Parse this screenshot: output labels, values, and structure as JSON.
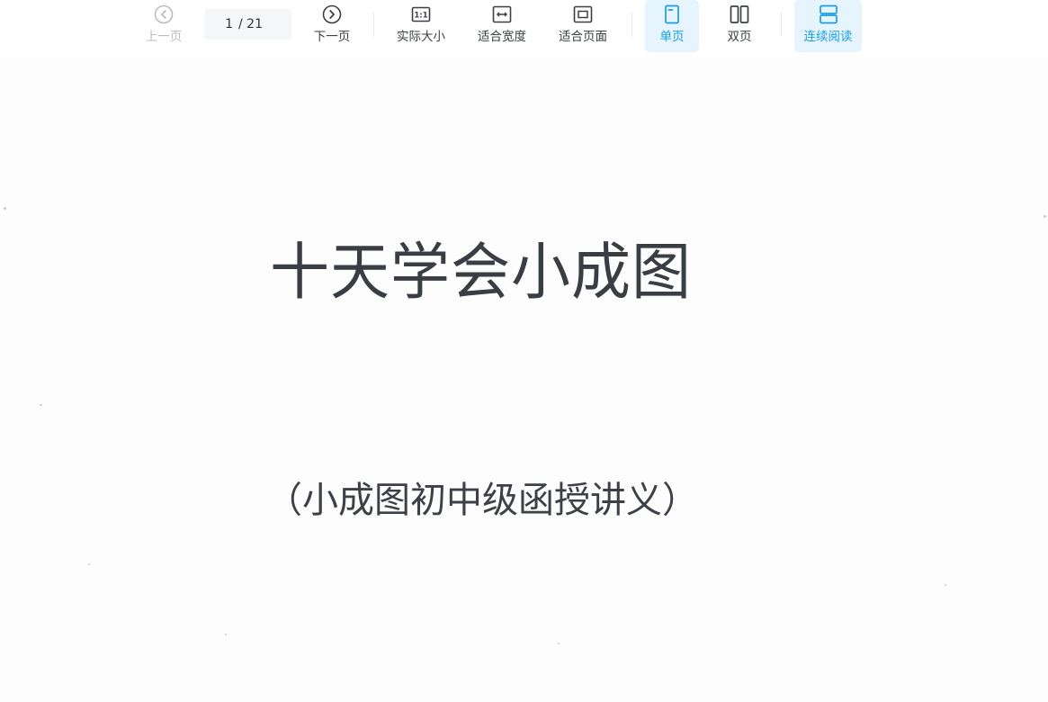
{
  "toolbar": {
    "prev_label": "上一页",
    "current_page": "1",
    "page_total": "/ 21",
    "next_label": "下一页",
    "actual_size_label": "实际大小",
    "fit_width_label": "适合宽度",
    "fit_page_label": "适合页面",
    "single_page_label": "单页",
    "double_page_label": "双页",
    "continuous_label": "连续阅读",
    "actual_size_icon_text": "1:1"
  },
  "colors": {
    "accent": "#1a9ee0",
    "active_bg": "#e6f4fd",
    "disabled": "#b9bcc2",
    "text": "#3b3f46"
  },
  "document": {
    "title": "十天学会小成图",
    "subtitle": "（小成图初中级函授讲义）"
  }
}
